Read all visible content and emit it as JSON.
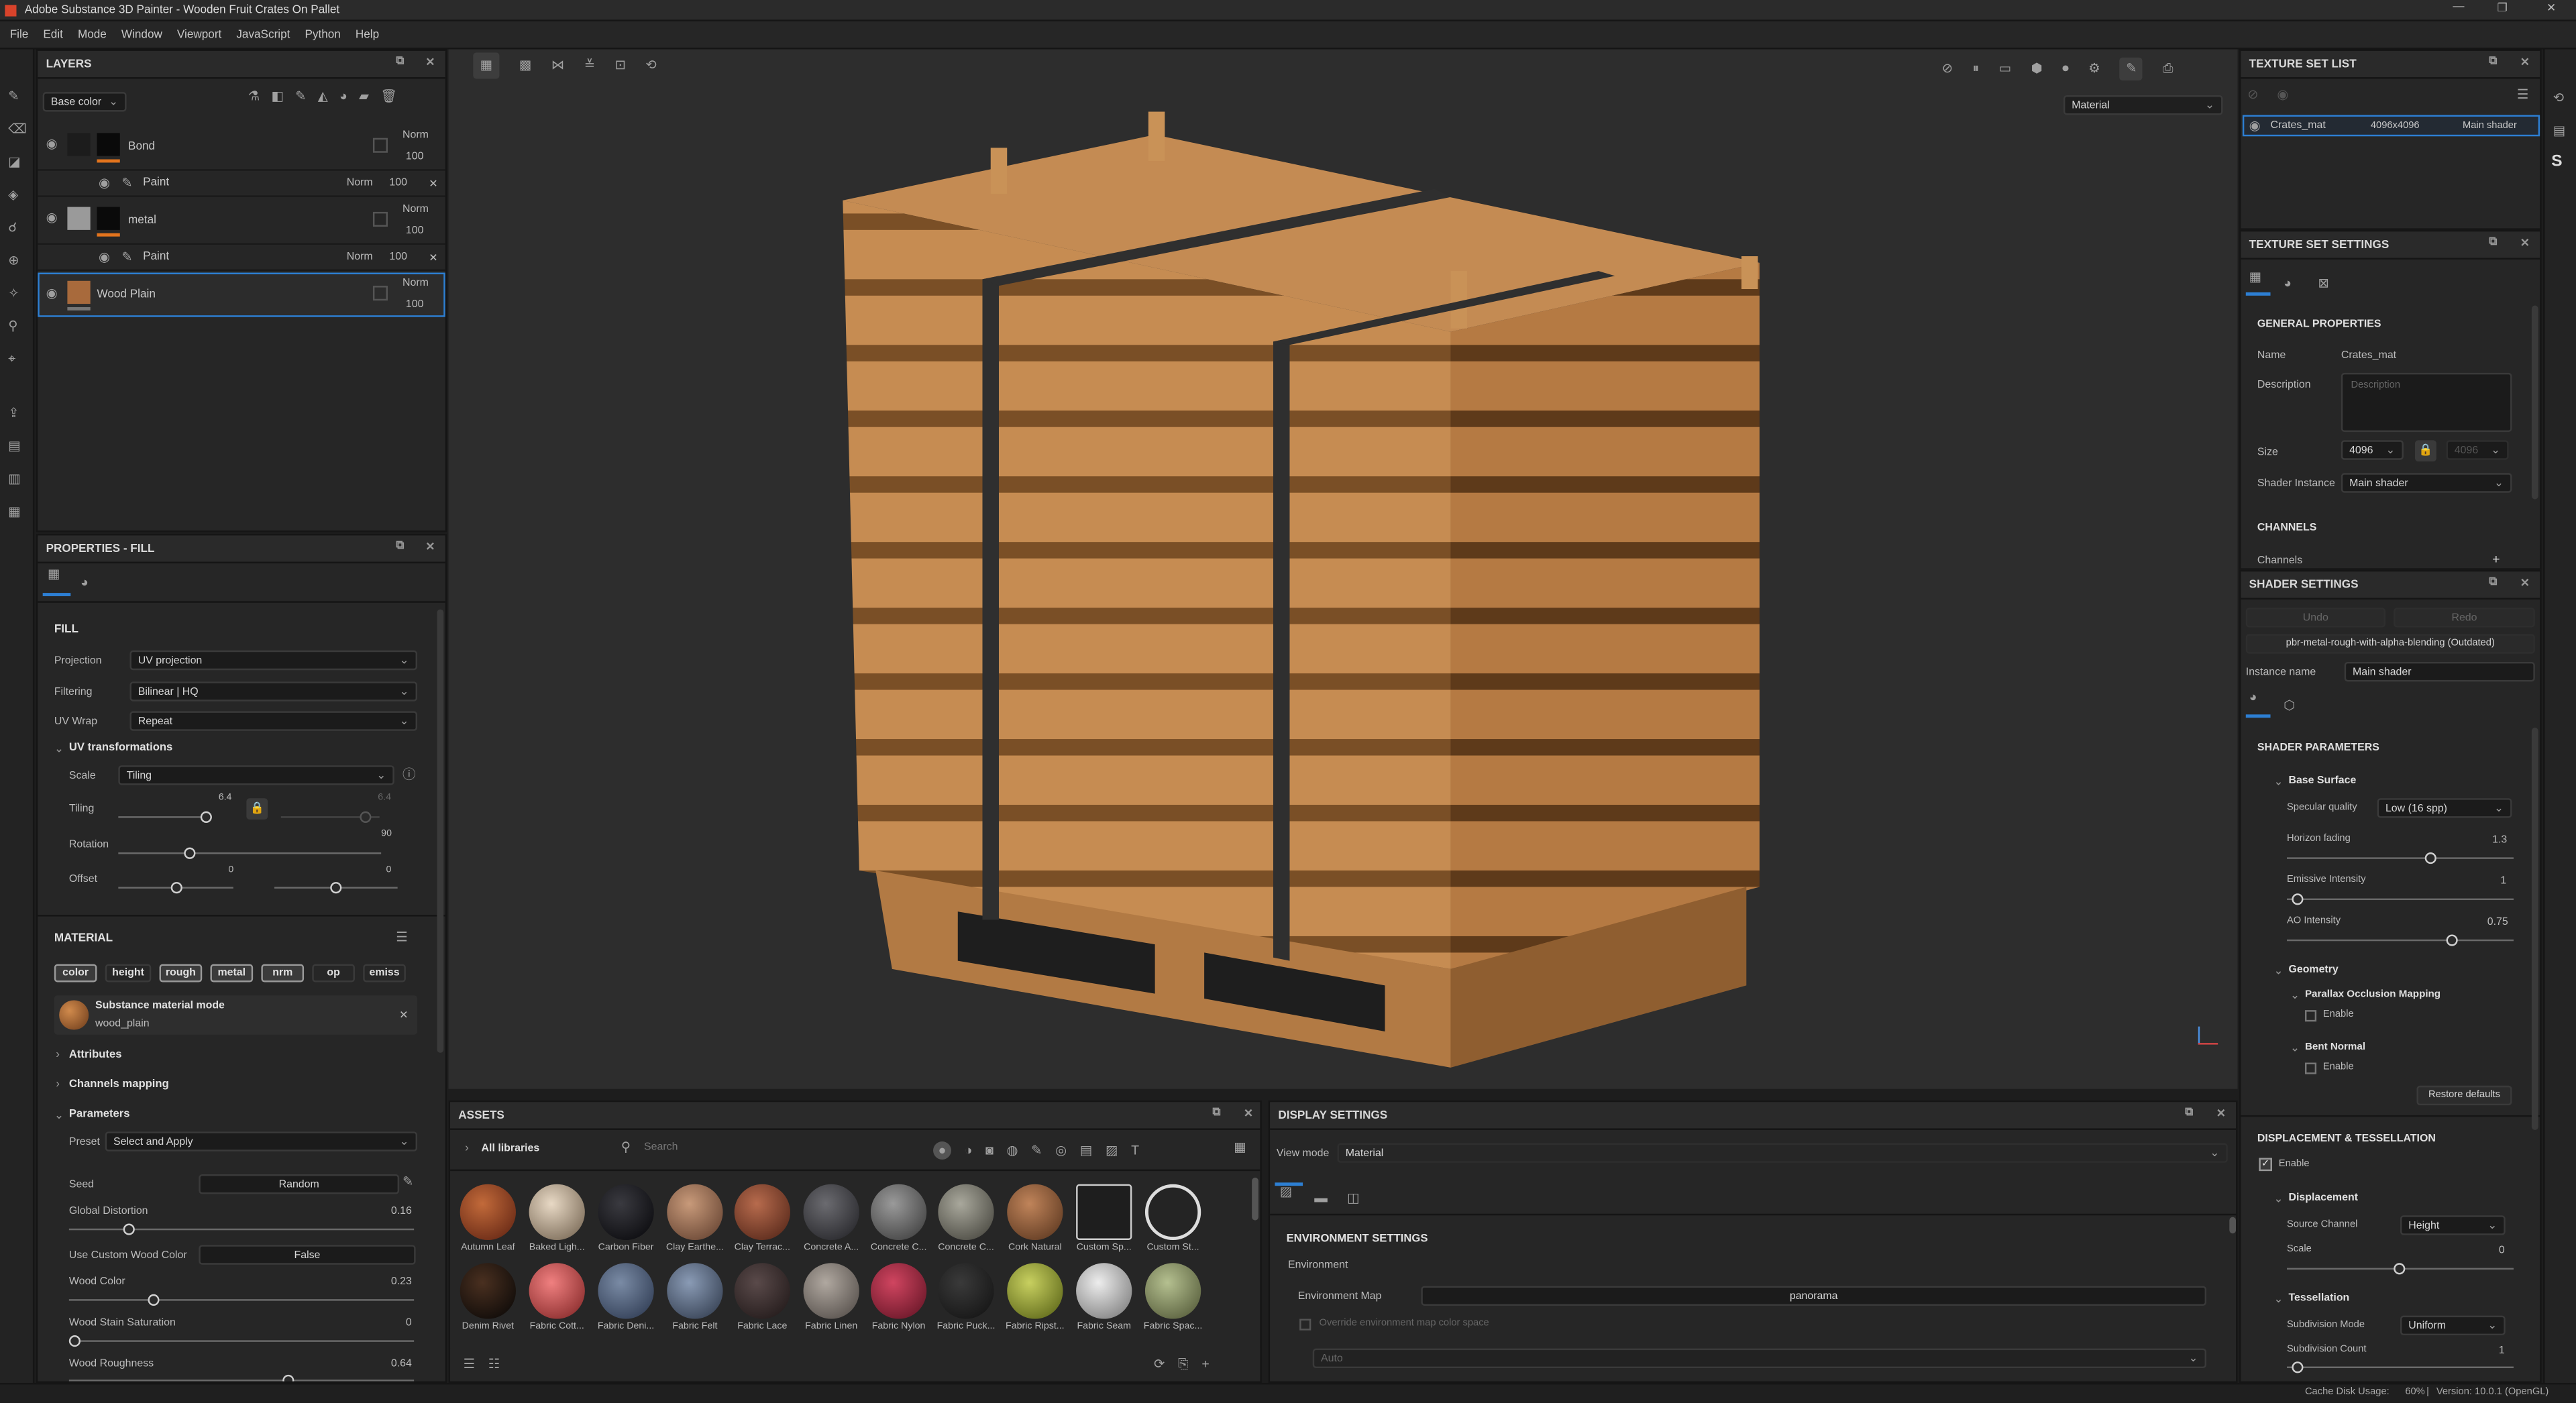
{
  "window": {
    "title": "Adobe Substance 3D Painter - Wooden Fruit Crates On Pallet"
  },
  "menu": [
    "File",
    "Edit",
    "Mode",
    "Window",
    "Viewport",
    "JavaScript",
    "Python",
    "Help"
  ],
  "layers": {
    "title": "LAYERS",
    "channel": "Base color",
    "items": [
      {
        "name": "Bond",
        "blend": "Norm",
        "opacity": "100"
      },
      {
        "name": "Paint",
        "blend": "Norm",
        "opacity": "100"
      },
      {
        "name": "metal",
        "blend": "Norm",
        "opacity": "100"
      },
      {
        "name": "Paint",
        "blend": "Norm",
        "opacity": "100"
      },
      {
        "name": "Wood Plain",
        "blend": "Norm",
        "opacity": "100"
      }
    ]
  },
  "props": {
    "title": "PROPERTIES - FILL",
    "fill_title": "FILL",
    "projection_label": "Projection",
    "projection": "UV projection",
    "filtering_label": "Filtering",
    "filtering": "Bilinear | HQ",
    "uvwrap_label": "UV Wrap",
    "uvwrap": "Repeat",
    "uvtrans": "UV transformations",
    "scale_label": "Scale",
    "scale": "Tiling",
    "tiling_label": "Tiling",
    "tiling_value": "6.4",
    "tiling_value2": "6.4",
    "rotation_label": "Rotation",
    "rotation_value": "90",
    "offset_label": "Offset",
    "offset_x": "0",
    "offset_y": "0",
    "material_title": "MATERIAL",
    "chips": [
      "color",
      "height",
      "rough",
      "metal",
      "nrm",
      "op",
      "emiss"
    ],
    "mat_mode": "Substance material mode",
    "mat_name": "wood_plain",
    "attributes": "Attributes",
    "channels_mapping": "Channels mapping",
    "parameters": "Parameters",
    "preset_label": "Preset",
    "preset": "Select and Apply",
    "seed_label": "Seed",
    "seed": "Random",
    "gd_label": "Global Distortion",
    "gd": "0.16",
    "ucwc_label": "Use Custom Wood Color",
    "ucwc": "False",
    "wc_label": "Wood Color",
    "wc": "0.23",
    "wss_label": "Wood Stain Saturation",
    "wss": "0",
    "wr_label": "Wood Roughness",
    "wr": "0.64"
  },
  "viewport": {
    "mode": "Material"
  },
  "assets": {
    "title": "ASSETS",
    "libraries": "All libraries",
    "search_placeholder": "Search",
    "row1": [
      "Autumn Leaf",
      "Baked Ligh...",
      "Carbon Fiber",
      "Clay Earthe...",
      "Clay Terrac...",
      "Concrete A...",
      "Concrete C...",
      "Concrete C...",
      "Cork Natural",
      "Custom Sp...",
      "Custom St..."
    ],
    "row2": [
      "Denim Rivet",
      "Fabric Cott...",
      "Fabric Deni...",
      "Fabric Felt",
      "Fabric Lace",
      "Fabric Linen",
      "Fabric Nylon",
      "Fabric Puck...",
      "Fabric Ripst...",
      "Fabric Seam",
      "Fabric Spac..."
    ]
  },
  "display": {
    "title": "DISPLAY SETTINGS",
    "viewmode_label": "View mode",
    "viewmode": "Material",
    "env_title": "ENVIRONMENT SETTINGS",
    "env": "Environment",
    "envmap_label": "Environment Map",
    "envmap": "panorama",
    "override": "Override environment map color space",
    "auto": "Auto"
  },
  "tsl": {
    "title": "TEXTURE SET LIST",
    "name": "Crates_mat",
    "size": "4096x4096",
    "shader": "Main shader"
  },
  "tss": {
    "title": "TEXTURE SET SETTINGS",
    "general": "GENERAL PROPERTIES",
    "name_label": "Name",
    "name": "Crates_mat",
    "desc_label": "Description",
    "desc_placeholder": "Description",
    "size_label": "Size",
    "size": "4096",
    "size2": "4096",
    "shader_label": "Shader Instance",
    "shader": "Main shader",
    "channels_title": "CHANNELS",
    "channels_label": "Channels"
  },
  "shader": {
    "title": "SHADER SETTINGS",
    "undo": "Undo",
    "redo": "Redo",
    "shader_file": "pbr-metal-rough-with-alpha-blending (Outdated)",
    "inst_label": "Instance name",
    "inst": "Main shader",
    "params": "SHADER PARAMETERS",
    "base_surface": "Base Surface",
    "spec_label": "Specular quality",
    "spec": "Low (16 spp)",
    "horizon_label": "Horizon fading",
    "horizon": "1.3",
    "emissive_label": "Emissive Intensity",
    "emissive": "1",
    "ao_label": "AO Intensity",
    "ao": "0.75",
    "geometry": "Geometry",
    "pom": "Parallax Occlusion Mapping",
    "enable": "Enable",
    "bent": "Bent Normal",
    "enable2": "Enable",
    "restore": "Restore defaults",
    "disp_title": "DISPLACEMENT & TESSELLATION",
    "disp_enable": "Enable",
    "displacement": "Displacement",
    "source_label": "Source Channel",
    "source": "Height",
    "scale_label": "Scale",
    "scale": "0",
    "tess": "Tessellation",
    "subdmode_label": "Subdivision Mode",
    "subdmode": "Uniform",
    "subdcount_label": "Subdivision Count",
    "subdcount": "1"
  },
  "status": {
    "disk_label": "Cache Disk Usage:",
    "disk": "60%",
    "version": "Version: 10.0.1 (OpenGL)"
  },
  "colors": {
    "accent": "#2d7fd3",
    "orange": "#e3741d",
    "wood": "#c58a4f"
  }
}
